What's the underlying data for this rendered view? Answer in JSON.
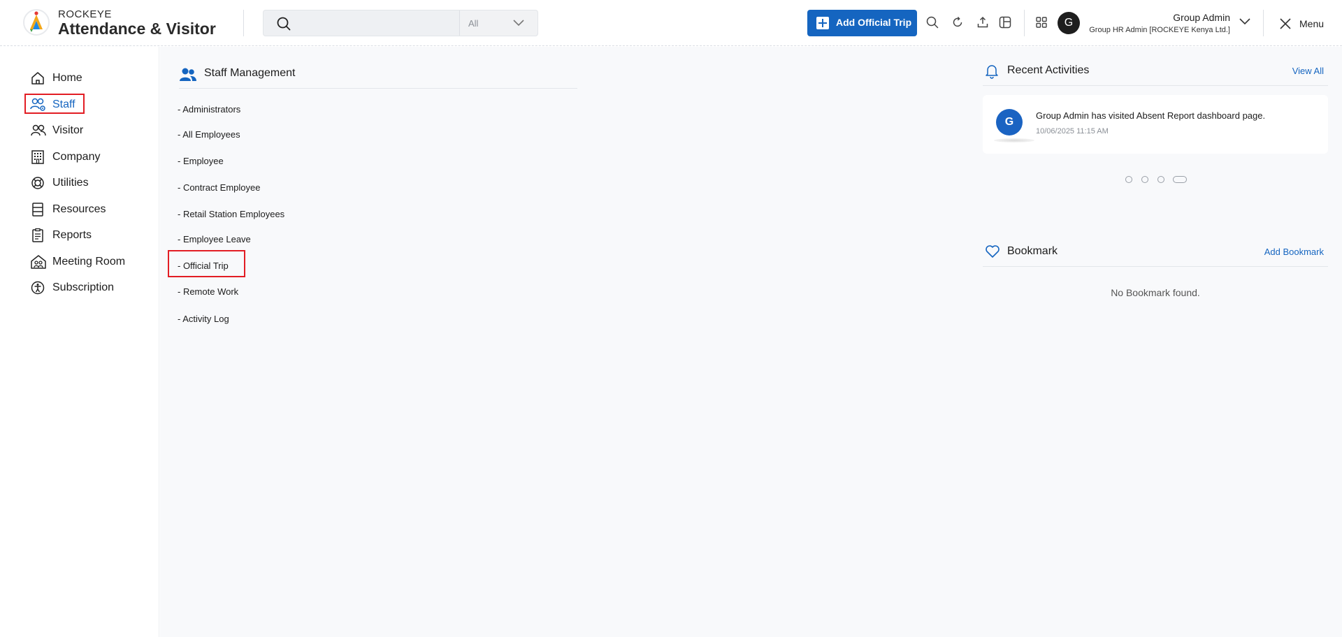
{
  "header": {
    "brand_top": "ROCKEYE",
    "brand_main": "Attendance & Visitor",
    "search": {
      "placeholder": "",
      "filter_value": "All"
    },
    "primary_action": "Add Official Trip",
    "user": {
      "initial": "G",
      "name": "Group Admin",
      "role": "Group HR Admin [ROCKEYE Kenya Ltd.]"
    },
    "menu_label": "Menu"
  },
  "sidebar": {
    "items": [
      {
        "label": "Home",
        "icon": "home-icon"
      },
      {
        "label": "Staff",
        "icon": "staff-icon",
        "active": true
      },
      {
        "label": "Visitor",
        "icon": "visitor-icon"
      },
      {
        "label": "Company",
        "icon": "company-icon"
      },
      {
        "label": "Utilities",
        "icon": "utilities-icon"
      },
      {
        "label": "Resources",
        "icon": "resources-icon"
      },
      {
        "label": "Reports",
        "icon": "reports-icon"
      },
      {
        "label": "Meeting Room",
        "icon": "meeting-room-icon"
      },
      {
        "label": "Subscription",
        "icon": "subscription-icon"
      }
    ]
  },
  "main": {
    "section_title": "Staff Management",
    "items": [
      "- Administrators",
      "- All Employees",
      "- Employee",
      "- Contract Employee",
      "- Retail Station Employees",
      "- Employee Leave",
      "- Official Trip",
      "- Remote Work",
      "- Activity Log"
    ]
  },
  "activities": {
    "title": "Recent Activities",
    "link": "View All",
    "entries": [
      {
        "initial": "G",
        "message": "Group Admin has visited Absent Report dashboard page.",
        "time": "10/06/2025 11:15 AM"
      }
    ],
    "carousel_pages": 4,
    "carousel_active": 4
  },
  "bookmark": {
    "title": "Bookmark",
    "link": "Add Bookmark",
    "empty": "No Bookmark found."
  },
  "colors": {
    "accent": "#1565c0",
    "highlight": "#e21d24",
    "main_bg": "#f8f9fb"
  }
}
